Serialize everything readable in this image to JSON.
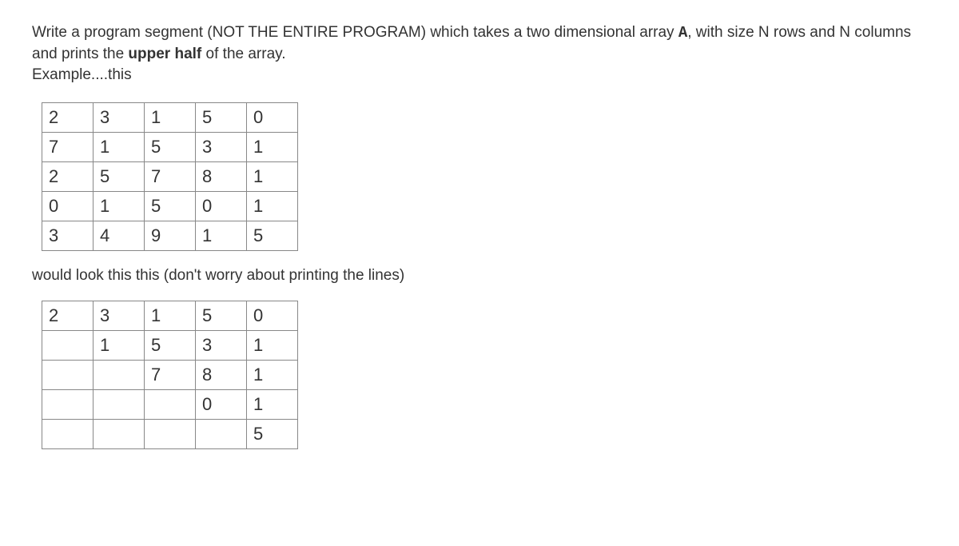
{
  "intro_part1": "Write a program segment (NOT THE ENTIRE PROGRAM) which takes a two dimensional array ",
  "intro_code": "A",
  "intro_part2": ", with size N rows and N columns and prints the ",
  "intro_bold": "upper half",
  "intro_part3": " of the array.",
  "example_label": "Example....this",
  "table1": {
    "rows": [
      [
        "2",
        "3",
        "1",
        "5",
        "0"
      ],
      [
        "7",
        "1",
        "5",
        "3",
        "1"
      ],
      [
        "2",
        "5",
        "7",
        "8",
        "1"
      ],
      [
        "0",
        "1",
        "5",
        "0",
        "1"
      ],
      [
        "3",
        "4",
        "9",
        "1",
        "5"
      ]
    ]
  },
  "between_text": "would look this this (don't worry about printing the lines)",
  "table2": {
    "rows": [
      [
        "2",
        "3",
        "1",
        "5",
        "0"
      ],
      [
        "",
        "1",
        "5",
        "3",
        "1"
      ],
      [
        "",
        "",
        "7",
        "8",
        "1"
      ],
      [
        "",
        "",
        "",
        "0",
        "1"
      ],
      [
        "",
        "",
        "",
        "",
        "5"
      ]
    ]
  }
}
